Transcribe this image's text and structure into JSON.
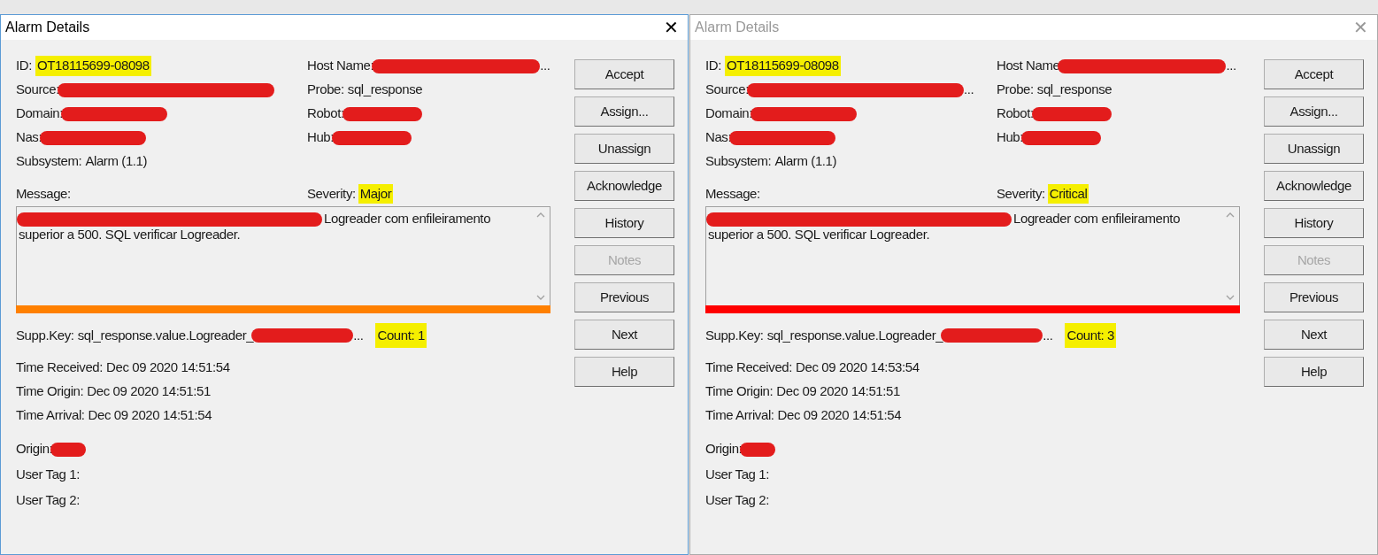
{
  "dialogs": [
    {
      "title": "Alarm Details",
      "active": true,
      "close": "✕",
      "fields_left": [
        {
          "label": "ID:",
          "value": "OT18115699-08098",
          "highlighted": true
        },
        {
          "label": "Source:",
          "redacted": true
        },
        {
          "label": "Domain:",
          "redacted": true
        },
        {
          "label": "Nas:",
          "redacted": true
        },
        {
          "label": "Subsystem:",
          "value": "Alarm (1.1)",
          "highlighted": false
        }
      ],
      "fields_right": [
        {
          "label": "Host Name:",
          "redacted": true,
          "tail": "..."
        },
        {
          "label": "Probe:",
          "value": "sql_response",
          "highlighted": false
        },
        {
          "label": "Robot:",
          "redacted": true
        },
        {
          "label": "Hub:",
          "redacted": true
        }
      ],
      "message_label": "Message:",
      "severity": {
        "label": "Severity:",
        "value": "Major",
        "highlighted": true
      },
      "message": {
        "redacted": true,
        "text": "Logreader com enfileiramento superior a 500. SQL verificar Logreader.",
        "color": "#ff8000"
      },
      "supp_key": {
        "label": "Supp.Key:",
        "value": "sql_response.value.Logreader_",
        "redacted": true,
        "tail": "..."
      },
      "count": {
        "text": "Count: 1",
        "highlighted": true
      },
      "times": [
        {
          "label": "Time Received:",
          "value": "Dec 09 2020 14:51:54"
        },
        {
          "label": "Time Origin:",
          "value": "Dec 09 2020 14:51:51"
        },
        {
          "label": "Time Arrival:",
          "value": "Dec 09 2020 14:51:54"
        }
      ],
      "tags": [
        {
          "label": "Origin:",
          "redacted": true
        },
        {
          "label": "User Tag 1:",
          "redacted": false
        },
        {
          "label": "User Tag 2:",
          "redacted": false
        }
      ],
      "buttons": [
        {
          "label": "Accept",
          "disabled": false
        },
        {
          "label": "Assign...",
          "disabled": false
        },
        {
          "label": "Unassign",
          "disabled": false
        },
        {
          "label": "Acknowledge",
          "disabled": false
        },
        {
          "label": "History",
          "disabled": false
        },
        {
          "label": "Notes",
          "disabled": true
        },
        {
          "label": "Previous",
          "disabled": false
        },
        {
          "label": "Next",
          "disabled": false
        },
        {
          "label": "Help",
          "disabled": false
        }
      ]
    },
    {
      "title": "Alarm Details",
      "active": false,
      "close": "✕",
      "fields_left": [
        {
          "label": "ID:",
          "value": "OT18115699-08098",
          "highlighted": true
        },
        {
          "label": "Source:",
          "redacted": true,
          "tail": "..."
        },
        {
          "label": "Domain:",
          "redacted": true
        },
        {
          "label": "Nas:",
          "redacted": true
        },
        {
          "label": "Subsystem:",
          "value": "Alarm (1.1)",
          "highlighted": false
        }
      ],
      "fields_right": [
        {
          "label": "Host Name",
          "redacted": true,
          "tail": "..."
        },
        {
          "label": "Probe:",
          "value": "sql_response",
          "highlighted": false
        },
        {
          "label": "Robot:",
          "redacted": true
        },
        {
          "label": "Hub:",
          "redacted": true
        }
      ],
      "message_label": "Message:",
      "severity": {
        "label": "Severity:",
        "value": "Critical",
        "highlighted": true
      },
      "message": {
        "redacted": true,
        "text": "Logreader com enfileiramento superior a 500. SQL verificar Logreader.",
        "color": "#ff0000"
      },
      "supp_key": {
        "label": "Supp.Key:",
        "value": "sql_response.value.Logreader_",
        "redacted": true,
        "tail": "..."
      },
      "count": {
        "text": "Count: 3",
        "highlighted": true
      },
      "times": [
        {
          "label": "Time Received:",
          "value": "Dec 09 2020 14:53:54"
        },
        {
          "label": "Time Origin:",
          "value": "Dec 09 2020 14:51:51"
        },
        {
          "label": "Time Arrival:",
          "value": "Dec 09 2020 14:51:54"
        }
      ],
      "tags": [
        {
          "label": "Origin:",
          "redacted": true
        },
        {
          "label": "User Tag 1:",
          "redacted": false
        },
        {
          "label": "User Tag 2:",
          "redacted": false
        }
      ],
      "buttons": [
        {
          "label": "Accept",
          "disabled": false
        },
        {
          "label": "Assign...",
          "disabled": false
        },
        {
          "label": "Unassign",
          "disabled": false
        },
        {
          "label": "Acknowledge",
          "disabled": false
        },
        {
          "label": "History",
          "disabled": false
        },
        {
          "label": "Notes",
          "disabled": true
        },
        {
          "label": "Previous",
          "disabled": false
        },
        {
          "label": "Next",
          "disabled": false
        },
        {
          "label": "Help",
          "disabled": false
        }
      ]
    }
  ]
}
